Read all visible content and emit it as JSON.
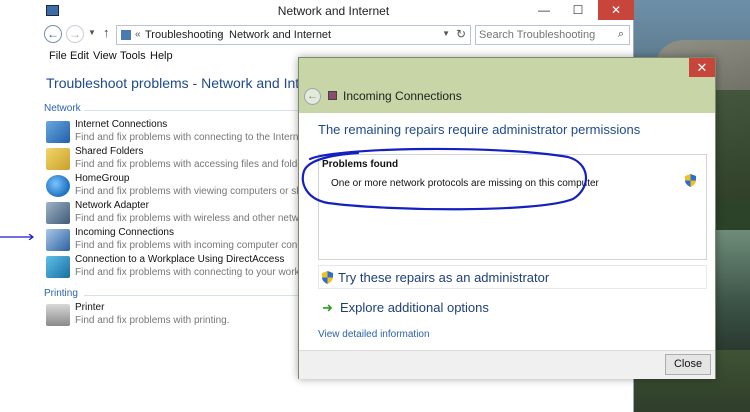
{
  "window": {
    "title": "Network and Internet",
    "controls": {
      "minimize": "—",
      "maximize": "☐",
      "close": "✕"
    }
  },
  "address": {
    "chevron": "«",
    "crumbs": [
      "Troubleshooting",
      "Network and Internet"
    ],
    "separator": "›",
    "search_placeholder": "Search Troubleshooting"
  },
  "menu": [
    "File",
    "Edit",
    "View",
    "Tools",
    "Help"
  ],
  "page_title": "Troubleshoot problems - Network and Internet",
  "groups": {
    "network": "Network",
    "printing": "Printing"
  },
  "items": [
    {
      "name": "Internet Connections",
      "desc": "Find and fix problems with connecting to the Internet or",
      "icon": "internet-connections-icon"
    },
    {
      "name": "Shared Folders",
      "desc": "Find and fix problems with accessing files and folders o",
      "icon": "shared-folders-icon"
    },
    {
      "name": "HomeGroup",
      "desc": "Find and fix problems with viewing computers or shared",
      "icon": "homegroup-icon"
    },
    {
      "name": "Network Adapter",
      "desc": "Find and fix problems with wireless and other network a",
      "icon": "network-adapter-icon"
    },
    {
      "name": "Incoming Connections",
      "desc": "Find and fix problems with incoming computer connectio",
      "icon": "incoming-connections-icon"
    },
    {
      "name": "Connection to a Workplace Using DirectAccess",
      "desc": "Find and fix problems with connecting to your workplac",
      "icon": "directaccess-icon"
    },
    {
      "name": "Printer",
      "desc": "Find and fix problems with printing.",
      "icon": "printer-icon"
    }
  ],
  "dialog": {
    "title": "Incoming Connections",
    "heading": "The remaining repairs require administrator permissions",
    "problems_header": "Problems found",
    "problem_message": "One or more network protocols are missing on this computer",
    "repair_label": "Try these repairs as an administrator",
    "explore_label": "Explore additional options",
    "detail_link": "View detailed information",
    "close_label": "Close"
  }
}
